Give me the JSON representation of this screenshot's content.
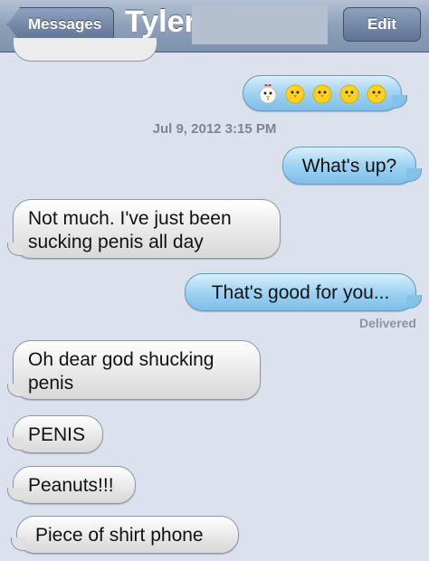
{
  "nav": {
    "back_label": "Messages",
    "title": "Tyler",
    "edit_label": "Edit"
  },
  "conversation": {
    "emoji_message": [
      "chicken-icon",
      "chick-icon",
      "chick-icon",
      "chick-icon",
      "chick-icon"
    ],
    "timestamp": "Jul 9, 2012 3:15 PM",
    "messages": [
      {
        "from": "me",
        "text": "What's up?"
      },
      {
        "from": "them",
        "text_line1": "Not much. I've just been",
        "text_line2": "sucking penis all day"
      },
      {
        "from": "me",
        "text": "That's good for you..."
      },
      {
        "status": "Delivered"
      },
      {
        "from": "them",
        "text_line1": "Oh dear god shucking",
        "text_line2": "penis"
      },
      {
        "from": "them",
        "text": "PENIS"
      },
      {
        "from": "them",
        "text": "Peanuts!!!"
      },
      {
        "from": "them",
        "text": "Piece of shirt phone"
      }
    ]
  },
  "colors": {
    "outgoing_bubble": "#9fd2f2",
    "incoming_bubble": "#e6e6e6",
    "background": "#dbe2ed",
    "navbar": "#8d9fb9"
  }
}
